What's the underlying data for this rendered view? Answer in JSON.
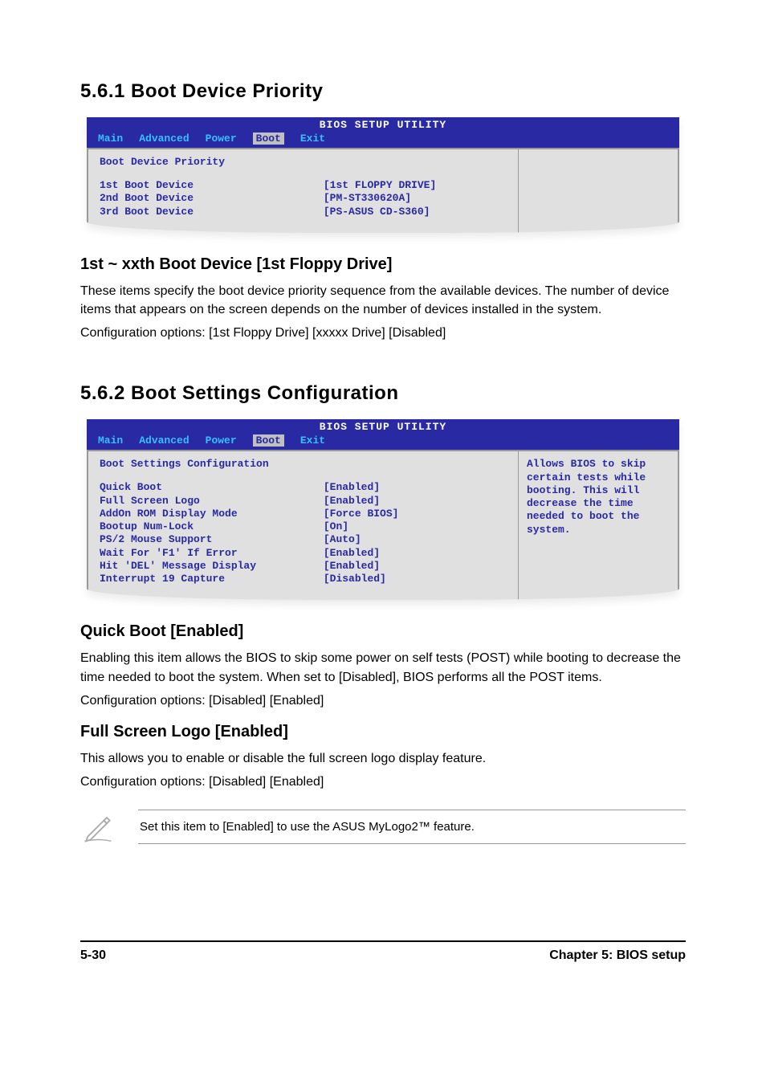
{
  "section_561": {
    "heading": "5.6.1   Boot Device Priority",
    "bios": {
      "title": "BIOS SETUP UTILITY",
      "menu": [
        "Main",
        "Advanced",
        "Power",
        "Boot",
        "Exit"
      ],
      "active_menu": "Boot",
      "section_title": "Boot Device Priority",
      "rows": [
        {
          "label": "1st Boot Device",
          "value": "[1st FLOPPY DRIVE]"
        },
        {
          "label": "2nd Boot Device",
          "value": "[PM-ST330620A]"
        },
        {
          "label": "3rd Boot Device",
          "value": "[PS-ASUS CD-S360]"
        }
      ]
    },
    "sub_heading": "1st ~ xxth Boot Device [1st Floppy Drive]",
    "para1": "These items specify the boot device priority sequence from the available devices. The number of device items that appears on the screen depends on the number of devices installed in the system.",
    "para2": "Configuration options: [1st Floppy Drive] [xxxxx Drive] [Disabled]"
  },
  "section_562": {
    "heading": "5.6.2   Boot Settings Configuration",
    "bios": {
      "title": "BIOS SETUP UTILITY",
      "menu": [
        "Main",
        "Advanced",
        "Power",
        "Boot",
        "Exit"
      ],
      "active_menu": "Boot",
      "section_title": "Boot Settings Configuration",
      "rows": [
        {
          "label": "Quick Boot",
          "value": "[Enabled]"
        },
        {
          "label": "Full Screen Logo",
          "value": "[Enabled]"
        },
        {
          "label": "AddOn ROM Display Mode",
          "value": "[Force BIOS]"
        },
        {
          "label": "Bootup Num-Lock",
          "value": "[On]"
        },
        {
          "label": "PS/2 Mouse Support",
          "value": "[Auto]"
        },
        {
          "label": "Wait For 'F1' If Error",
          "value": "[Enabled]"
        },
        {
          "label": "Hit 'DEL' Message Display",
          "value": "[Enabled]"
        },
        {
          "label": "Interrupt 19 Capture",
          "value": "[Disabled]"
        }
      ],
      "help": "Allows BIOS to skip certain tests while booting. This will decrease the time needed to boot the system."
    },
    "quickboot": {
      "heading": "Quick Boot [Enabled]",
      "para1": "Enabling this item allows the BIOS to skip some power on self tests (POST) while booting to decrease the time needed to boot the system. When set to [Disabled], BIOS performs all the POST items.",
      "para2": "Configuration options: [Disabled] [Enabled]"
    },
    "fullscreen": {
      "heading": "Full Screen Logo [Enabled]",
      "para1": "This allows you to enable or disable the full screen logo display feature.",
      "para2": "Configuration options: [Disabled] [Enabled]"
    },
    "note": "Set this item to [Enabled] to use the ASUS MyLogo2™ feature."
  },
  "footer": {
    "left": "5-30",
    "right": "Chapter 5: BIOS setup"
  }
}
